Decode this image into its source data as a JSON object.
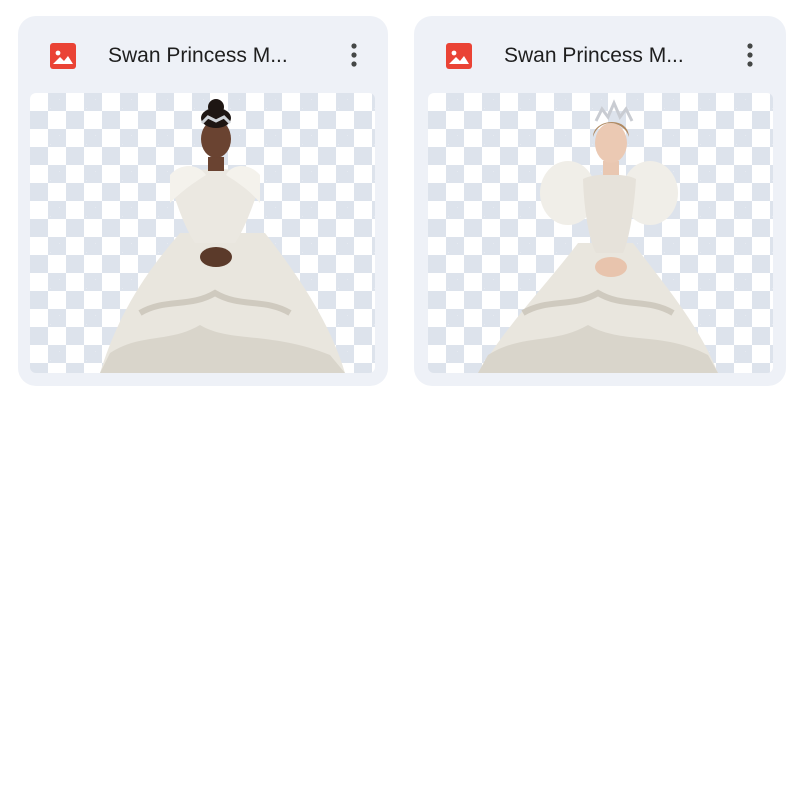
{
  "files": [
    {
      "name": "Swan Princess M...",
      "icon": "image-file-icon",
      "icon_color": "#ea4335",
      "menu_icon": "more-vertical-icon"
    },
    {
      "name": "Swan Princess M...",
      "icon": "image-file-icon",
      "icon_color": "#ea4335",
      "menu_icon": "more-vertical-icon"
    }
  ],
  "colors": {
    "card_background": "#eef1f7",
    "checker_light": "#ffffff",
    "checker_dark": "#dde3ec",
    "text": "#1f1f1f"
  }
}
